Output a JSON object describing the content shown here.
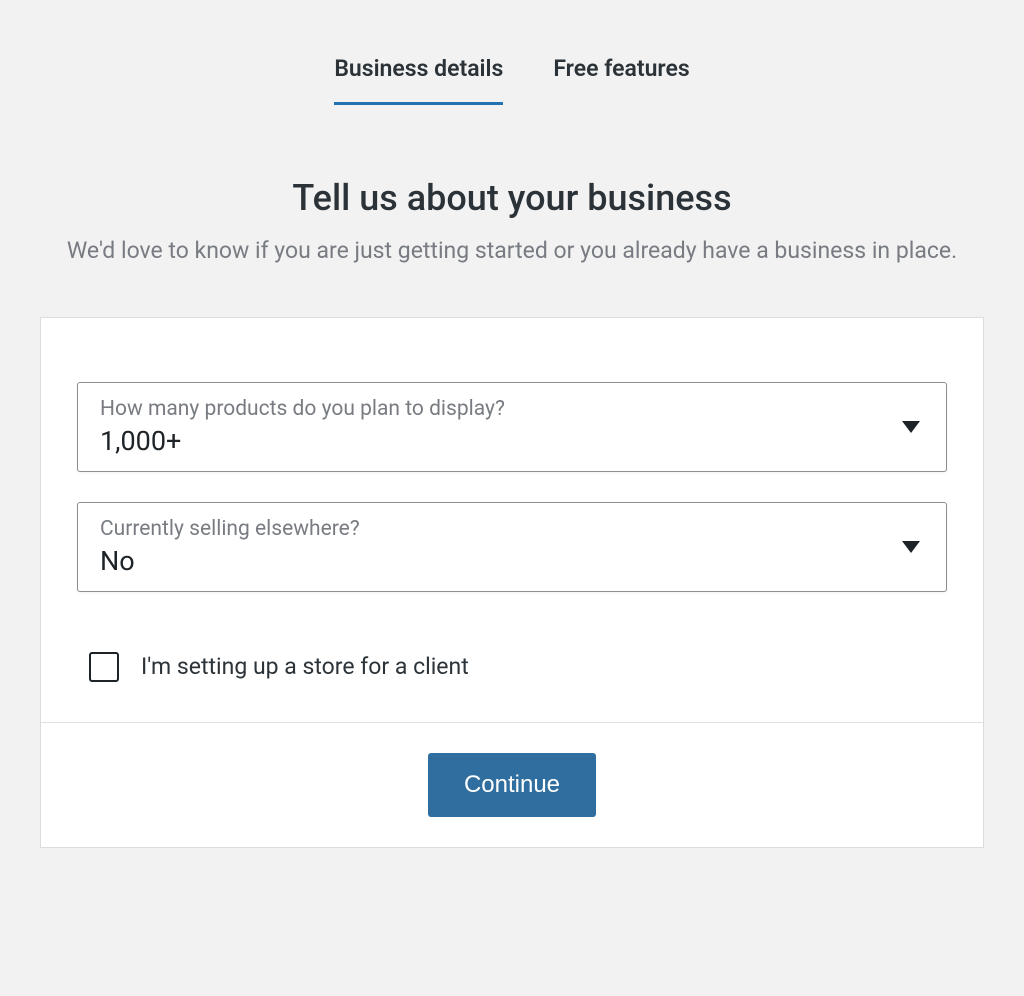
{
  "tabs": {
    "business_details": "Business details",
    "free_features": "Free features"
  },
  "heading": {
    "title": "Tell us about your business",
    "subtitle": "We'd love to know if you are just getting started or you already have a business in place."
  },
  "form": {
    "product_count": {
      "label": "How many products do you plan to display?",
      "value": "1,000+"
    },
    "selling_elsewhere": {
      "label": "Currently selling elsewhere?",
      "value": "No"
    },
    "client_checkbox": {
      "label": "I'm setting up a store for a client",
      "checked": false
    }
  },
  "actions": {
    "continue": "Continue"
  }
}
